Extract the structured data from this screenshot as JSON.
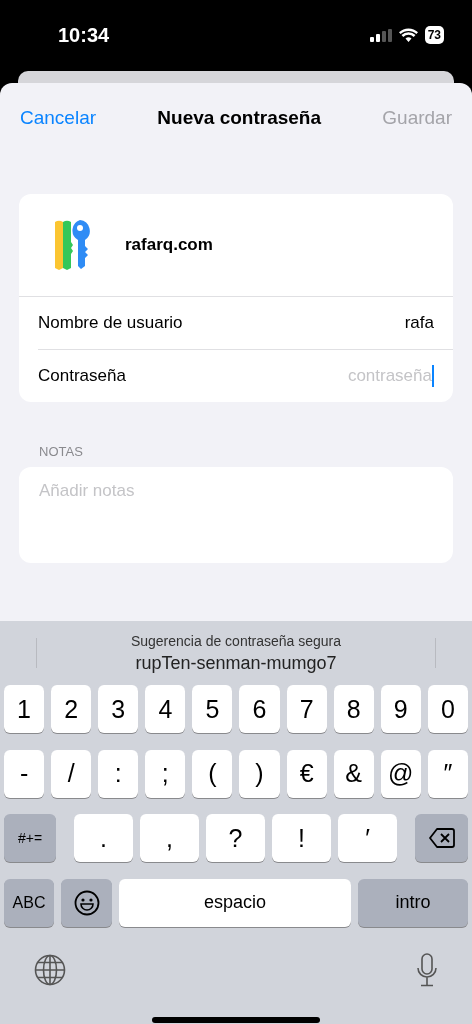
{
  "status_bar": {
    "time": "10:34",
    "battery": "73"
  },
  "nav": {
    "cancel": "Cancelar",
    "title": "Nueva contraseña",
    "save": {
      "label": "Guardar",
      "disabled": true
    }
  },
  "site": {
    "name": "rafarq.com"
  },
  "fields": [
    {
      "label": "Nombre de usuario",
      "value": "rafa",
      "focused": false
    },
    {
      "label": "Contraseña",
      "placeholder": "contraseña",
      "focused": true
    }
  ],
  "notes": {
    "label": "NOTAS",
    "placeholder": "Añadir notas"
  },
  "keyboard": {
    "suggestion": {
      "title": "Sugerencia de contraseña segura",
      "password": "rupTen-senman-mumgo7"
    },
    "number_row": [
      {
        "label": "1",
        "kind": "char"
      },
      {
        "label": "2",
        "kind": "char"
      },
      {
        "label": "3",
        "kind": "char"
      },
      {
        "label": "4",
        "kind": "char"
      },
      {
        "label": "5",
        "kind": "char"
      },
      {
        "label": "6",
        "kind": "char"
      },
      {
        "label": "7",
        "kind": "char"
      },
      {
        "label": "8",
        "kind": "char"
      },
      {
        "label": "9",
        "kind": "char"
      },
      {
        "label": "0",
        "kind": "char"
      }
    ],
    "symbol_row": [
      {
        "label": "-",
        "kind": "char"
      },
      {
        "label": "/",
        "kind": "char"
      },
      {
        "label": ":",
        "kind": "char"
      },
      {
        "label": ";",
        "kind": "char"
      },
      {
        "label": "(",
        "kind": "char"
      },
      {
        "label": ")",
        "kind": "char"
      },
      {
        "label": "€",
        "kind": "char"
      },
      {
        "label": "&",
        "kind": "char"
      },
      {
        "label": "@",
        "kind": "char"
      },
      {
        "label": "″",
        "kind": "char"
      }
    ],
    "punctuation_row": [
      {
        "label": "#+=",
        "kind": "shift"
      },
      {
        "label": ".",
        "kind": "char"
      },
      {
        "label": ",",
        "kind": "char"
      },
      {
        "label": "?",
        "kind": "char"
      },
      {
        "label": "!",
        "kind": "char"
      },
      {
        "label": "′",
        "kind": "char"
      },
      {
        "kind": "delete"
      }
    ],
    "bottom_row": [
      {
        "label": "ABC",
        "kind": "abc"
      },
      {
        "kind": "emoji"
      },
      {
        "label": "espacio",
        "kind": "space"
      },
      {
        "label": "intro",
        "kind": "return"
      }
    ]
  }
}
